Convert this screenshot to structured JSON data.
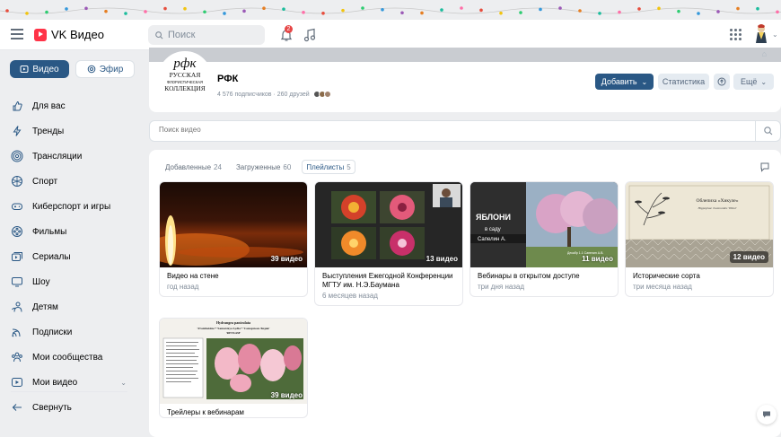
{
  "app": {
    "title": "VK Видео"
  },
  "topbar": {
    "search_placeholder": "Поиск",
    "notif_count": "2"
  },
  "sidebar": {
    "tabs": [
      {
        "label": "Видео"
      },
      {
        "label": "Эфир"
      }
    ],
    "items": [
      {
        "label": "Для вас",
        "icon": "thumbs-up-icon"
      },
      {
        "label": "Тренды",
        "icon": "lightning-icon"
      },
      {
        "label": "Трансляции",
        "icon": "broadcast-icon"
      },
      {
        "label": "Спорт",
        "icon": "ball-icon"
      },
      {
        "label": "Киберспорт и игры",
        "icon": "gamepad-icon"
      },
      {
        "label": "Фильмы",
        "icon": "film-reel-icon"
      },
      {
        "label": "Сериалы",
        "icon": "series-icon"
      },
      {
        "label": "Шоу",
        "icon": "tv-icon"
      },
      {
        "label": "Детям",
        "icon": "kids-icon"
      },
      {
        "label": "Подписки",
        "icon": "subscriptions-icon"
      },
      {
        "label": "Мои сообщества",
        "icon": "communities-icon"
      },
      {
        "label": "Мои видео",
        "icon": "my-video-icon"
      },
      {
        "label": "Свернуть",
        "icon": "arrow-left-icon"
      }
    ]
  },
  "group": {
    "logo_lines": [
      "РУССКАЯ",
      "ФЛОРИСТИЧЕСКАЯ",
      "КОЛЛЕКЦИЯ"
    ],
    "name": "РФК",
    "subtitle": "4 576 подписчиков · 260 друзей",
    "buttons": {
      "add": "Добавить",
      "stats": "Статистика",
      "more": "Ещё"
    }
  },
  "video_search": {
    "placeholder": "Поиск видео"
  },
  "tabs": [
    {
      "label": "Добавленные",
      "count": "24"
    },
    {
      "label": "Загруженные",
      "count": "60"
    },
    {
      "label": "Плейлисты",
      "count": "5"
    }
  ],
  "playlists": [
    {
      "title": "Видео на стене",
      "count": "39 видео",
      "date": "год назад"
    },
    {
      "title": "Выступления Ежегодной Конференции МГТУ им. Н.Э.Баумана",
      "count": "13 видео",
      "date": "6 месяцев назад"
    },
    {
      "title": "Вебинары в открытом доступе",
      "count": "11 видео",
      "date": "три дня назад",
      "thumb_text": [
        "ЯБЛОНИ",
        "в саду",
        "Сапелин А."
      ],
      "thumb_small": "Декабр 1.1 Сапелин А.В."
    },
    {
      "title": "Исторические сорта",
      "count": "12 видео",
      "date": "три месяца назад",
      "thumb_text": [
        "Облепиха «Хикуле»",
        "Hippophae rhamnoides 'Hikul'"
      ]
    },
    {
      "title": "Трейлеры к вебинарам",
      "count": "39 видео",
      "date": "",
      "thumb_text": [
        "Hydrangea paniculata",
        "'Framboisine'+'Samarskya Lydia'+'Самарская Лидия'",
        "'RENSAM'"
      ]
    }
  ],
  "colors": {
    "accent": "#2a5885",
    "brand": "#ff3347",
    "badge": "#e64646"
  }
}
